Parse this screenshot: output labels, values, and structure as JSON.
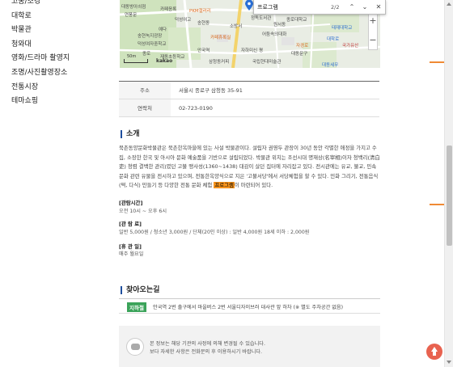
{
  "sidebar": {
    "items": [
      {
        "label": "고궁/조경"
      },
      {
        "label": "대학로"
      },
      {
        "label": "박물관"
      },
      {
        "label": "청와대"
      },
      {
        "label": "영화/드라마 촬영지"
      },
      {
        "label": "조명/사진촬영장소"
      },
      {
        "label": "전통시장"
      },
      {
        "label": "테마쇼핑"
      }
    ]
  },
  "find_bar": {
    "query": "프로그램",
    "count": "2/2",
    "prev_icon": "chevron-up-icon",
    "next_icon": "chevron-down-icon",
    "close_icon": "close-icon"
  },
  "map": {
    "labels": {
      "l1": "대동방아쇠점",
      "l2": "연풍문",
      "l3": "PKM갤러리",
      "l4": "카페응록",
      "l5": "덕성여고",
      "l6": "송현동",
      "l7": "카페휴록실",
      "l8": "예다",
      "l9": "덕성여자중학교",
      "l10": "어둠속의대화",
      "l11": "정독도서관",
      "l12": "원서동",
      "l13": "자경로",
      "l14": "태재대학교",
      "l15": "대동문구",
      "l16": "종로",
      "l17": "재동초등학교",
      "l18": "국가유산",
      "l19": "대학로",
      "l20": "자하미신 평",
      "l21": "종로대학교",
      "l22": "삼청동커피",
      "l23": "대동세무",
      "l24": "안국역",
      "l25": "국립현대미술관",
      "l26": "소방서",
      "l27": "송현녹지광장"
    },
    "kakao": "kakao",
    "scale_label": "50m",
    "zoom_in": "+",
    "zoom_out": "−"
  },
  "info": {
    "address_label": "주소",
    "address_value": "서울시 종로구 삼청동 35-91",
    "contact_label": "연락처",
    "contact_value": "02-723-0190"
  },
  "intro": {
    "title": "소개",
    "text_before": "북촌동양문화박물관은 북촌한옥마을에 있는 사설 박물관이다. 설립자 권영두 관장이 30년 동안 각별한 애정을 가지고 수집, 소장한 한국 및 아시아 문화 예술품을 기반으로 설립되었다. 박물관 위치는 조선시대 명재상(名宰相)이자 청백리(淸白吏) 청렴 결백한 관리)였던 고불 맹사성(1360~1438) 대감이 살던 집터에 자리잡고 있다. 전시관에는 유교, 불교, 민속문화 관련 유물을 전시하고 있으며, 전통한옥양식으로 지은 '고불서당'에서 서당체험을 할 수 있다. 민화 그리기, 전통음식(떡, 다식) 만들기 등 다양한 전통 문화 체험 ",
    "highlight": "프로그램",
    "text_after": "이 마련되어 있다."
  },
  "details": {
    "hours_label": "[관람시간]",
    "hours_value": "오전 10시 ~ 오후 6시",
    "fee_label": "[관 람 료]",
    "fee_value": "일반 5,000원 / 청소년 3,000원 / 단체(20인 이상) : 일반 4,000원 18세 이하 : 2,000원",
    "closed_label": "[휴 관 일]",
    "closed_value": "매주 월요일"
  },
  "directions": {
    "title": "찾아오는길",
    "badge": "지하철",
    "text": "안국역 2번 출구에서 마을버스 2번 서울디자이브러 대사관 앞 하차 (※ 별도 주차공간 없음)"
  },
  "notice": {
    "icon": "chat-bubble-icon",
    "line1": "본 정보는 해당 기관의 사정에 의해 변경될 수 있습니다.",
    "line2": "보다 자세한 사항은 전화문의 후 이용하시기 바랍니다."
  },
  "colors": {
    "accent": "#f08a34",
    "highlight": "#f7941d",
    "section_bar": "#1f4f9e",
    "badge": "#3ba35a",
    "top_button": "#e8624f"
  }
}
